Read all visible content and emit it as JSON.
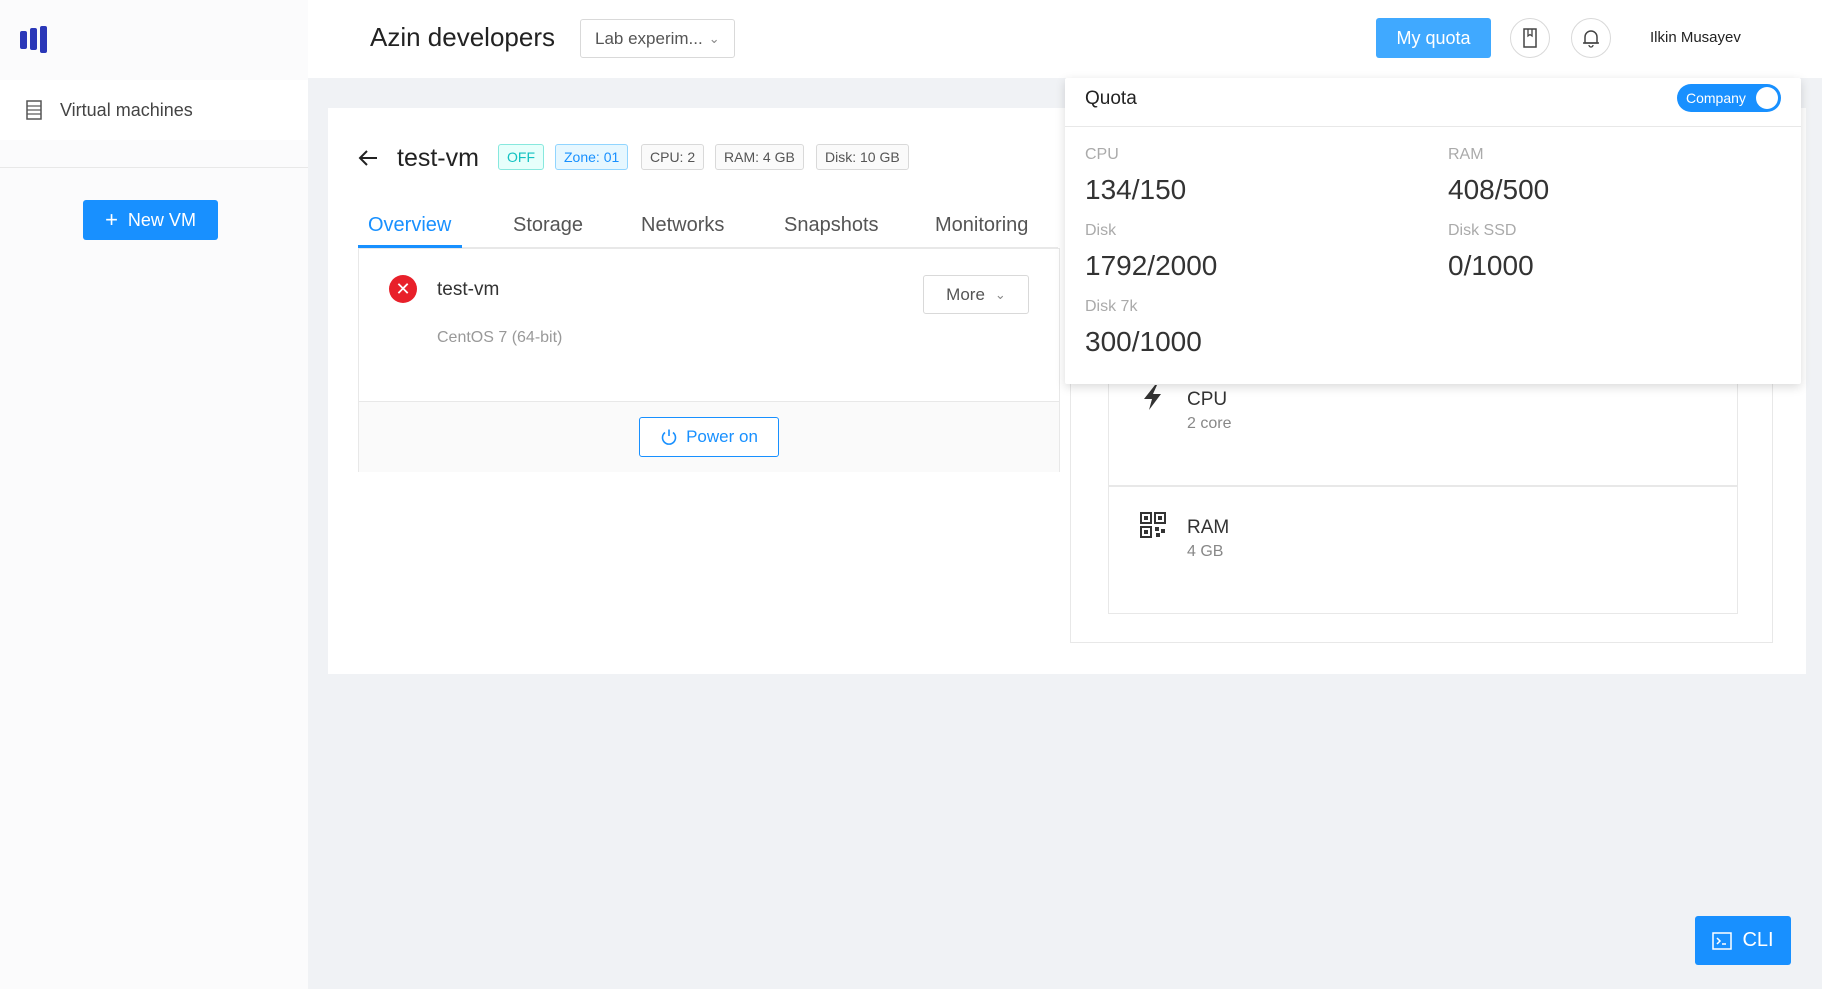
{
  "sidebar": {
    "logo_icon": "brand-bars-icon",
    "items": [
      {
        "label": "Virtual machines",
        "icon": "server-list-icon"
      }
    ],
    "new_vm_label": "New VM"
  },
  "header": {
    "org_title": "Azin developers",
    "project_select": "Lab experim...",
    "quota_button": "My quota",
    "bookmark_icon": "bookmark-icon",
    "bell_icon": "bell-icon",
    "username": "Ilkin Musayev"
  },
  "vm": {
    "title": "test-vm",
    "tags": {
      "status": "OFF",
      "zone": "Zone: 01",
      "cpu": "CPU: 2",
      "ram": "RAM: 4 GB",
      "disk": "Disk: 10 GB"
    },
    "tabs": [
      "Overview",
      "Storage",
      "Networks",
      "Snapshots",
      "Monitoring"
    ],
    "active_tab": "Overview",
    "name": "test-vm",
    "os": "CentOS 7 (64-bit)",
    "more_label": "More",
    "power_label": "Power on",
    "specs": [
      {
        "label": "CPU",
        "value": "2 core",
        "icon": "lightning-icon"
      },
      {
        "label": "RAM",
        "value": "4 GB",
        "icon": "qr-grid-icon"
      }
    ]
  },
  "quota": {
    "title": "Quota",
    "toggle_label": "Company",
    "toggle_on": true,
    "items": {
      "cpu": {
        "label": "CPU",
        "value": "134/150"
      },
      "ram": {
        "label": "RAM",
        "value": "408/500"
      },
      "disk": {
        "label": "Disk",
        "value": "1792/2000"
      },
      "disk_ssd": {
        "label": "Disk SSD",
        "value": "0/1000"
      },
      "disk_7k": {
        "label": "Disk 7k",
        "value": "300/1000"
      }
    }
  },
  "cli_label": "CLI",
  "colors": {
    "primary": "#1890ff",
    "error": "#e8202a",
    "brand": "#2a37b8"
  }
}
